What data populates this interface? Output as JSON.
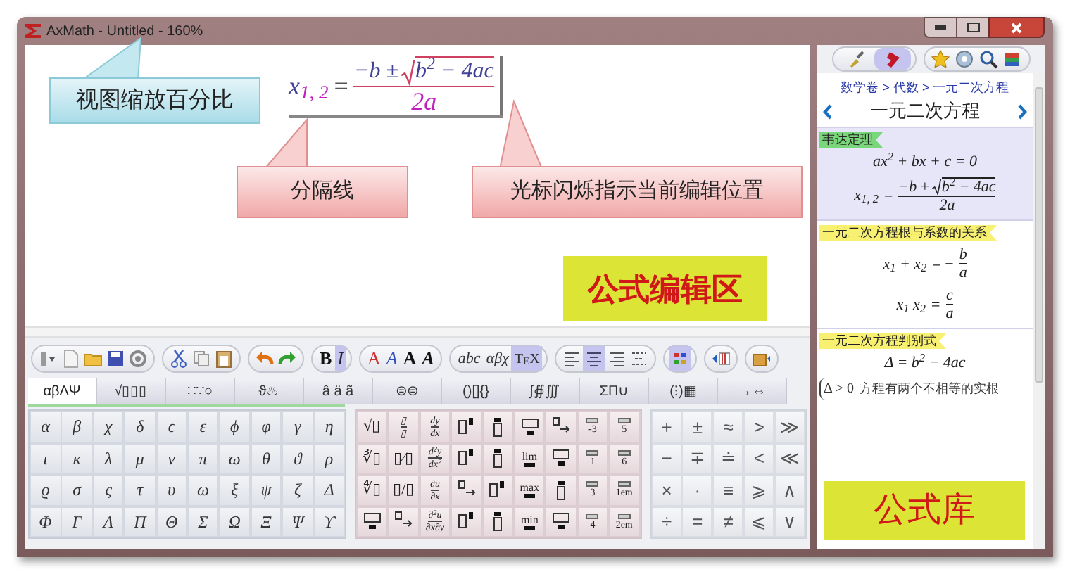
{
  "window": {
    "title": "AxMath - Untitled - 160%"
  },
  "editor": {
    "formula": {
      "lhs": "x$_{1, 2}$",
      "eq": "=",
      "num": "−b ±",
      "radicand": "b$^{2}$ − 4ac",
      "den": "2a"
    },
    "callouts": [
      {
        "kind": "info",
        "text": "视图缩放百分比"
      },
      {
        "kind": "note",
        "text": "分隔线"
      },
      {
        "kind": "note",
        "text": "光标闪烁指示当前编辑位置"
      },
      {
        "kind": "label",
        "text": "公式编辑区"
      }
    ]
  },
  "toolbar": [
    [
      {
        "kind": "icon",
        "selected": false
      },
      {
        "kind": "icon",
        "selected": false
      },
      {
        "kind": "icon",
        "selected": false
      },
      {
        "kind": "icon",
        "selected": false
      },
      {
        "kind": "icon",
        "selected": false
      }
    ],
    [
      {
        "kind": "icon",
        "selected": false
      },
      {
        "kind": "icon",
        "selected": false
      },
      {
        "kind": "icon",
        "selected": false
      }
    ],
    [
      {
        "kind": "icon",
        "selected": false
      },
      {
        "kind": "icon",
        "selected": false
      }
    ],
    [
      {
        "kind": "text",
        "text": "B",
        "selected": false
      },
      {
        "kind": "text",
        "text": "I",
        "selected": true
      }
    ],
    [
      {
        "kind": "text",
        "text": "A",
        "selected": false
      },
      {
        "kind": "text",
        "text": "A",
        "selected": false
      },
      {
        "kind": "text",
        "text": "A",
        "selected": false
      },
      {
        "kind": "text",
        "text": "A",
        "selected": false
      }
    ],
    [
      {
        "kind": "text",
        "text": "abc",
        "selected": false
      },
      {
        "kind": "text",
        "text": "αβχ",
        "selected": false
      },
      {
        "kind": "text",
        "text": "T$_{E}$X",
        "selected": true
      }
    ],
    [
      {
        "kind": "icon",
        "selected": false
      },
      {
        "kind": "icon",
        "selected": true
      },
      {
        "kind": "icon",
        "selected": false
      },
      {
        "kind": "icon",
        "selected": false
      }
    ],
    [
      {
        "kind": "icon",
        "selected": true
      }
    ],
    [
      {
        "kind": "icon",
        "selected": false
      }
    ],
    [
      {
        "kind": "icon",
        "selected": false
      }
    ]
  ],
  "symbol_tabs": [
    {
      "label": "αβΛΨ",
      "selected": true
    },
    {
      "label": "√▯▯▯",
      "selected": false
    },
    {
      "label": "∷∵○",
      "selected": false
    },
    {
      "label": "ϑ♨",
      "selected": false
    },
    {
      "label": "â ä ã",
      "selected": false
    },
    {
      "label": "⊜⊜",
      "selected": false
    },
    {
      "label": "()[]{}",
      "selected": false
    },
    {
      "label": "∫∯∭",
      "selected": false
    },
    {
      "label": "ΣΠ∪",
      "selected": false
    },
    {
      "label": "(⁝)▦",
      "selected": false
    },
    {
      "label": "→⇔",
      "selected": false
    }
  ],
  "greek_palette": [
    [
      "α",
      "β",
      "χ",
      "δ",
      "ϵ",
      "ε",
      "ϕ",
      "φ",
      "γ",
      "η"
    ],
    [
      "ι",
      "κ",
      "λ",
      "μ",
      "ν",
      "π",
      "ϖ",
      "θ",
      "ϑ",
      "ρ"
    ],
    [
      "ϱ",
      "σ",
      "ς",
      "τ",
      "υ",
      "ω",
      "ξ",
      "ψ",
      "ζ",
      "Δ"
    ],
    [
      "Φ",
      "Γ",
      "Λ",
      "Π",
      "Θ",
      "Σ",
      "Ω",
      "Ξ",
      "Ψ",
      "ϒ"
    ]
  ],
  "template_palette": [
    [
      {
        "kind": "text",
        "text": "√▯"
      },
      {
        "kind": "frac",
        "num": "▯",
        "den": "▯"
      },
      {
        "kind": "frac",
        "num": "dy",
        "den": "dx"
      },
      {
        "kind": "icon"
      },
      {
        "kind": "icon"
      },
      {
        "kind": "icon"
      },
      {
        "kind": "icon"
      },
      {
        "kind": "space",
        "text": "-3"
      },
      {
        "kind": "space",
        "text": "5"
      }
    ],
    [
      {
        "kind": "text",
        "text": "∛▯"
      },
      {
        "kind": "text",
        "text": "▯⁄▯"
      },
      {
        "kind": "frac",
        "num": "d$^{2}$y",
        "den": "dx$^{2}$"
      },
      {
        "kind": "icon"
      },
      {
        "kind": "icon"
      },
      {
        "kind": "limit",
        "text": "lim"
      },
      {
        "kind": "icon"
      },
      {
        "kind": "space",
        "text": "1"
      },
      {
        "kind": "space",
        "text": "6"
      }
    ],
    [
      {
        "kind": "text",
        "text": "∜▯"
      },
      {
        "kind": "text",
        "text": "▯/▯"
      },
      {
        "kind": "frac",
        "num": "∂u",
        "den": "∂x"
      },
      {
        "kind": "icon"
      },
      {
        "kind": "icon"
      },
      {
        "kind": "limit",
        "text": "max"
      },
      {
        "kind": "icon"
      },
      {
        "kind": "space",
        "text": "3"
      },
      {
        "kind": "space",
        "text": "1em"
      }
    ],
    [
      {
        "kind": "icon"
      },
      {
        "kind": "icon"
      },
      {
        "kind": "frac",
        "num": "∂$^{2}$u",
        "den": "∂x∂y"
      },
      {
        "kind": "icon"
      },
      {
        "kind": "icon"
      },
      {
        "kind": "limit",
        "text": "min"
      },
      {
        "kind": "icon"
      },
      {
        "kind": "space",
        "text": "4"
      },
      {
        "kind": "space",
        "text": "2em"
      }
    ]
  ],
  "operator_palette": [
    [
      "+",
      "±",
      "≈",
      ">",
      "≫"
    ],
    [
      "−",
      "∓",
      "≐",
      "<",
      "≪"
    ],
    [
      "×",
      "·",
      "≡",
      "⩾",
      "∧"
    ],
    [
      "÷",
      "=",
      "≠",
      "⩽",
      "∨"
    ]
  ],
  "library": {
    "toolbar": [
      [
        {
          "selected": false
        },
        {
          "selected": true
        }
      ],
      [
        {
          "selected": false
        },
        {
          "selected": false
        },
        {
          "selected": false
        },
        {
          "selected": false
        }
      ]
    ],
    "breadcrumb": "数学卷 > 代数 > 一元二次方程",
    "title": "一元二次方程",
    "sections": [
      {
        "tag": "韦达定理",
        "color": "#7ad67a",
        "highlighted": true,
        "items": [
          {
            "kind": "line",
            "text": "ax$^{2}$ + bx + c = 0"
          },
          {
            "kind": "frac",
            "lhs": "x$_{1, 2}$",
            "eq": "=",
            "num": "−b ±",
            "radicand": "b$^{2}$ − 4ac",
            "den": "2a"
          }
        ]
      },
      {
        "tag": "一元二次方程根与系数的关系",
        "color": "#f8f070",
        "highlighted": false,
        "items": [
          {
            "kind": "frac",
            "lhs": "x$_{1}$ + x$_{2}$",
            "eq": "= −",
            "num": "b",
            "den": "a"
          },
          {
            "kind": "frac",
            "lhs": "x$_{1}$ x$_{2}$",
            "eq": "=",
            "num": "c",
            "den": "a"
          }
        ]
      },
      {
        "tag": "一元二次方程判别式",
        "color": "#f8f070",
        "highlighted": false,
        "items": [
          {
            "kind": "line",
            "text": "Δ = b$^{2}$ − 4ac"
          },
          {
            "kind": "case",
            "cond": "Δ > 0",
            "text": "方程有两个不相等的实根"
          }
        ]
      }
    ],
    "overlay_label": "公式库"
  }
}
